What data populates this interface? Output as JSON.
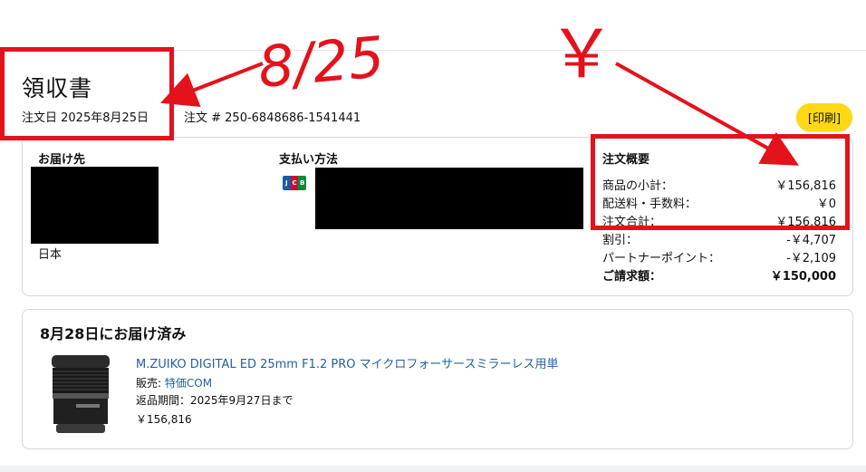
{
  "header": {
    "title": "領収書",
    "order_date": "注文日 2025年8月25日",
    "order_number": "注文 # 250-6848686-1541441",
    "print_button": "[印刷]"
  },
  "shipping": {
    "heading": "お届け先",
    "country": "日本"
  },
  "payment": {
    "heading": "支払い方法",
    "card_brand": "JCB"
  },
  "summary": {
    "heading": "注文概要",
    "rows": [
      {
        "label": "商品の小計：",
        "value": "￥156,816"
      },
      {
        "label": "配送料・手数料：",
        "value": "￥0"
      },
      {
        "label": "注文合計：",
        "value": "￥156,816"
      },
      {
        "label": "割引：",
        "value": "-￥4,707"
      },
      {
        "label": "パートナーポイント：",
        "value": "-￥2,109"
      },
      {
        "label": "ご請求額：",
        "value": "￥150,000"
      }
    ]
  },
  "delivery": {
    "heading": "8月28日にお届け済み",
    "product": {
      "title": "M.ZUIKO DIGITAL ED 25mm F1.2 PRO マイクロフォーサースミラーレス用単",
      "seller_prefix": "販売:",
      "seller_name": "特価COM",
      "return_period": "返品期間：2025年9月27日まで",
      "price": "￥156,816"
    }
  },
  "annotations": {
    "date_note": "8/25",
    "yen_note": "￥",
    "color": "#e3121b"
  }
}
